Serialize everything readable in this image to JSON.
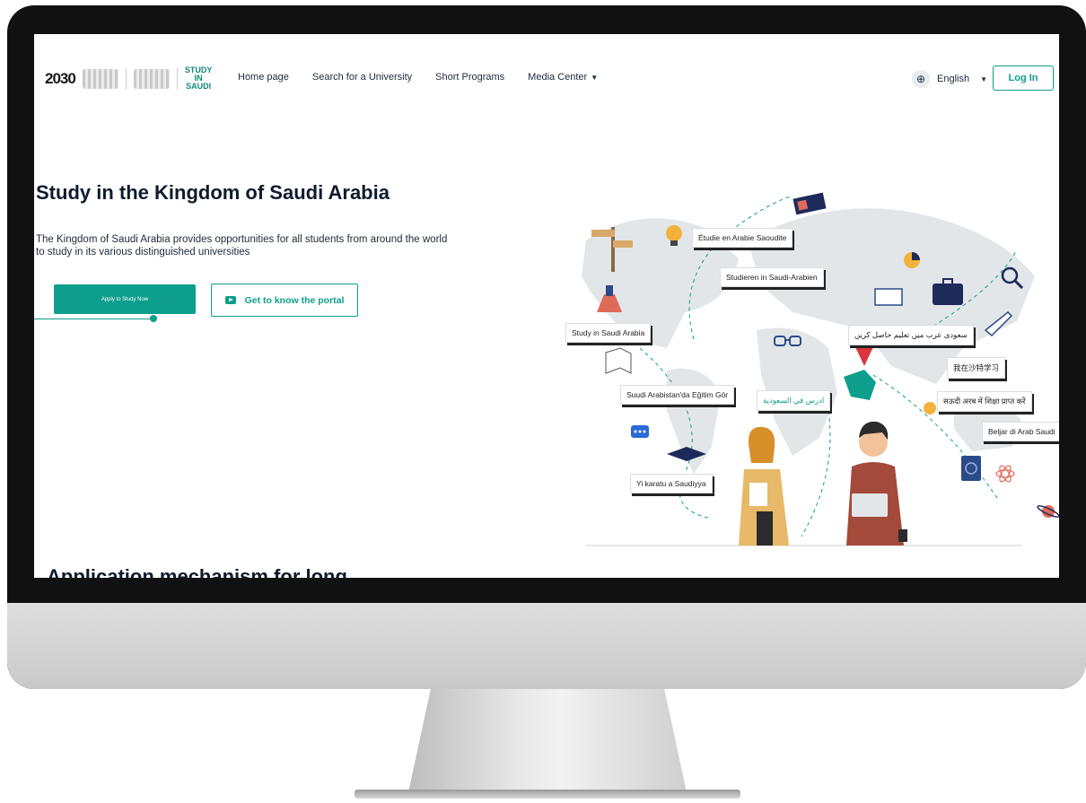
{
  "nav": {
    "logo_2030": "2030",
    "logo_study": [
      "STUDY",
      "IN",
      "SAUDI"
    ],
    "links": [
      "Home page",
      "Search for a University",
      "Short Programs",
      "Media Center"
    ],
    "language": "English",
    "login": "Log In"
  },
  "hero": {
    "title": "Study in the Kingdom of Saudi Arabia",
    "description": "The Kingdom of Saudi Arabia provides opportunities for all students from around the world to study in its various distinguished universities",
    "apply_button": "Apply to Study Now",
    "portal_button": "Get to know the portal"
  },
  "tags": {
    "fr": "Étudie en Arabie Saoudite",
    "de": "Studieren in Saudi-Arabien",
    "en": "Study in Saudi Arabia",
    "ur": "سعودی عرب میں تعلیم حاصل کریں",
    "zh": "我在沙特学习",
    "tr": "Suudi Arabistan'da Eğitim Gör",
    "ar": "ادرس في السعودية",
    "hi": "सऊदी अरब में शिक्षा प्राप्त करें",
    "id": "Beljar di Arab Saudi",
    "ha": "Yi karatu a Saudiyya"
  },
  "next_section": {
    "heading": "Application mechanism for long"
  },
  "colors": {
    "accent": "#0d9e8c",
    "text_dark": "#0f1b2d"
  }
}
